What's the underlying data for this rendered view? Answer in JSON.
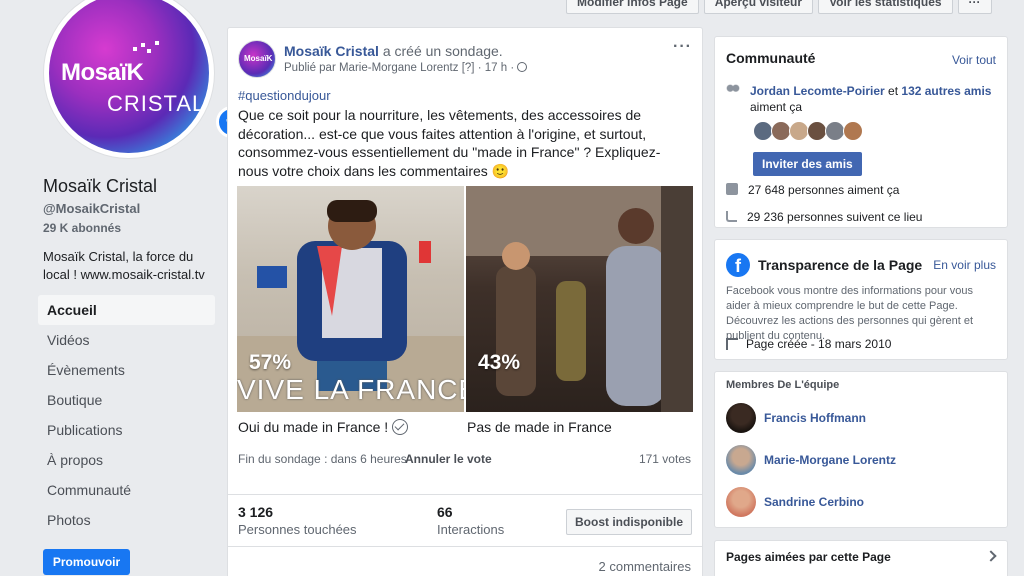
{
  "topbar": {
    "edit_info": "Modifier infos Page",
    "visitor_preview": "Aperçu visiteur",
    "view_stats": "Voir les statistiques",
    "more": "···"
  },
  "page": {
    "logo_text_top": "MosaïK",
    "logo_text_bottom": "CRISTAL",
    "name": "Mosaïk Cristal",
    "handle": "@MosaikCristal",
    "followers": "29 K abonnés",
    "tagline": "Mosaïk Cristal, la force du local ! www.mosaik-cristal.tv"
  },
  "nav": {
    "items": [
      {
        "label": "Accueil",
        "active": true
      },
      {
        "label": "Vidéos"
      },
      {
        "label": "Évènements"
      },
      {
        "label": "Boutique"
      },
      {
        "label": "Publications"
      },
      {
        "label": "À propos"
      },
      {
        "label": "Communauté"
      },
      {
        "label": "Photos"
      }
    ],
    "promote": "Promouvoir"
  },
  "post": {
    "author": "Mosaïk Cristal",
    "action": " a créé un sondage.",
    "published_by": "Publié par Marie-Morgane Lorentz",
    "tag": "[?]",
    "time": "17 h",
    "hashtag": "#questiondujour",
    "body": "Que ce soit pour la nourriture, les vêtements, des accessoires de décoration... est-ce que vous faites attention à l'origine, et surtout, consommez-vous essentiellement du \"made in France\" ? Expliquez-nous votre choix dans les commentaires 🙂",
    "options": [
      {
        "percent": "57%",
        "overlay": "VIVE LA FRANCE",
        "label": "Oui du made in France !",
        "value": 57
      },
      {
        "percent": "43%",
        "label": "Pas de made in France",
        "value": 43
      }
    ],
    "poll_end": "Fin du sondage : dans 6 heures",
    "cancel_vote": "Annuler le vote",
    "votes": "171 votes",
    "reach": "3 126",
    "reach_label": "Personnes touchées",
    "interactions": "66",
    "interactions_label": "Interactions",
    "boost": "Boost indisponible",
    "comments": "2 commentaires"
  },
  "community": {
    "title": "Communauté",
    "see_all": "Voir tout",
    "friend_name": "Jordan Lecomte-Poirier",
    "and": " et ",
    "others": "132 autres amis",
    "likes_this": "aiment ça",
    "invite": "Inviter des amis",
    "likes": "27 648 personnes aiment ça",
    "follows": "29 236 personnes suivent ce lieu"
  },
  "transparency": {
    "title": "Transparence de la Page",
    "see_more": "En voir plus",
    "text": "Facebook vous montre des informations pour vous aider à mieux comprendre le but de cette Page. Découvrez les actions des personnes qui gèrent et publient du contenu.",
    "created": "Page créée - 18 mars 2010"
  },
  "team": {
    "title": "Membres De L'équipe",
    "members": [
      "Francis Hoffmann",
      "Marie-Morgane Lorentz",
      "Sandrine Cerbino"
    ]
  },
  "liked_pages": {
    "title": "Pages aimées par cette Page"
  },
  "colors": {
    "accent": "#1877f2",
    "link": "#385898",
    "background": "#e9ebee"
  }
}
